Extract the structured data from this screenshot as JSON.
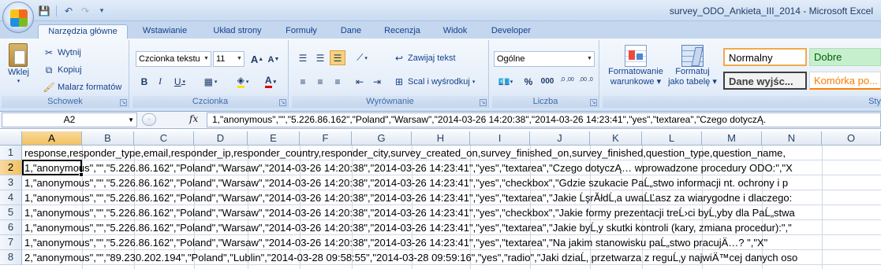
{
  "window": {
    "title": "survey_ODO_Ankieta_III_2014 - Microsoft Excel"
  },
  "quick_access": [
    {
      "icon": "save-icon",
      "glyph": "💾"
    },
    {
      "icon": "undo-icon",
      "glyph": "↶"
    },
    {
      "icon": "redo-icon",
      "glyph": "↷"
    },
    {
      "icon": "customize-qat-icon",
      "glyph": "▾"
    }
  ],
  "tabs": [
    {
      "label": "Narzędzia główne",
      "active": true
    },
    {
      "label": "Wstawianie"
    },
    {
      "label": "Układ strony"
    },
    {
      "label": "Formuły"
    },
    {
      "label": "Dane"
    },
    {
      "label": "Recenzja"
    },
    {
      "label": "Widok"
    },
    {
      "label": "Developer"
    }
  ],
  "ribbon": {
    "clipboard": {
      "paste": "Wklej",
      "cut": "Wytnij",
      "copy": "Kopiuj",
      "format_painter": "Malarz formatów",
      "group": "Schowek"
    },
    "font": {
      "font_name": "Czcionka tekstu",
      "font_size": "11",
      "bold": "B",
      "italic": "I",
      "underline": "U",
      "grow": "A",
      "shrink": "A",
      "font_color": "A",
      "group": "Czcionka"
    },
    "alignment": {
      "wrap_text": "Zawijaj tekst",
      "merge_center": "Scal i wyśrodkuj",
      "group": "Wyrównanie"
    },
    "number": {
      "format": "Ogólne",
      "percent": "%",
      "thousands": "000",
      "inc_decimal": ",0 ,00",
      "dec_decimal": ",00 ,0",
      "group": "Liczba"
    },
    "styles": {
      "conditional_formatting": "Formatowanie",
      "conditional_formatting_2": "warunkowe",
      "format_as_table": "Formatuj",
      "format_as_table_2": "jako tabelę",
      "normal": "Normalny",
      "good": "Dobre",
      "output": "Dane wyjśc...",
      "linked_cell": "Komórka po...",
      "group": "Sty"
    }
  },
  "formula_bar": {
    "name_box": "A2",
    "fx": "fx",
    "content": "1,\"anonymous\",\"\",\"5.226.86.162\",\"Poland\",\"Warsaw\",\"2014-03-26 14:20:38\",\"2014-03-26 14:23:41\",\"yes\",\"textarea\",\"Czego dotyczĄ."
  },
  "grid": {
    "columns": [
      "A",
      "B",
      "C",
      "D",
      "E",
      "F",
      "G",
      "H",
      "I",
      "J",
      "K",
      "L",
      "M",
      "N",
      "O"
    ],
    "selected_column": "A",
    "selected_row": "2",
    "rows": [
      {
        "num": "1",
        "text": "response,responder_type,email,responder_ip,responder_country,responder_city,survey_created_on,survey_finished_on,survey_finished,question_type,question_name,"
      },
      {
        "num": "2",
        "text": "1,\"anonymous\",\"\",\"5.226.86.162\",\"Poland\",\"Warsaw\",\"2014-03-26 14:20:38\",\"2014-03-26 14:23:41\",\"yes\",\"textarea\",\"Czego dotyczĄ… wprowadzone procedury ODO:\",\"X"
      },
      {
        "num": "3",
        "text": "1,\"anonymous\",\"\",\"5.226.86.162\",\"Poland\",\"Warsaw\",\"2014-03-26 14:20:38\",\"2014-03-26 14:23:41\",\"yes\",\"checkbox\",\"Gdzie szukacie PaĹ„stwo informacji nt. ochrony i p"
      },
      {
        "num": "4",
        "text": "1,\"anonymous\",\"\",\"5.226.86.162\",\"Poland\",\"Warsaw\",\"2014-03-26 14:20:38\",\"2014-03-26 14:23:41\",\"yes\",\"textarea\",\"Jakie ĹşrĂłdĹ‚a uwaĹĽasz za wiarygodne i dlaczego:"
      },
      {
        "num": "5",
        "text": "1,\"anonymous\",\"\",\"5.226.86.162\",\"Poland\",\"Warsaw\",\"2014-03-26 14:20:38\",\"2014-03-26 14:23:41\",\"yes\",\"checkbox\",\"Jakie formy prezentacji treĹ›ci byĹ‚yby dla PaĹ„stwa"
      },
      {
        "num": "6",
        "text": "1,\"anonymous\",\"\",\"5.226.86.162\",\"Poland\",\"Warsaw\",\"2014-03-26 14:20:38\",\"2014-03-26 14:23:41\",\"yes\",\"textarea\",\"Jakie byĹ‚y skutki kontroli (kary, zmiana procedur):\",\""
      },
      {
        "num": "7",
        "text": "1,\"anonymous\",\"\",\"5.226.86.162\",\"Poland\",\"Warsaw\",\"2014-03-26 14:20:38\",\"2014-03-26 14:23:41\",\"yes\",\"textarea\",\"Na jakim stanowisku paĹ„stwo pracujÄ…? \",\"X\""
      },
      {
        "num": "8",
        "text": "2,\"anonymous\",\"\",\"89.230.202.194\",\"Poland\",\"Lublin\",\"2014-03-28 09:58:55\",\"2014-03-28 09:59:16\",\"yes\",\"radio\",\"Jaki dziaĹ‚ przetwarza z reguĹ‚y najwiÄ™cej danych oso"
      }
    ]
  }
}
